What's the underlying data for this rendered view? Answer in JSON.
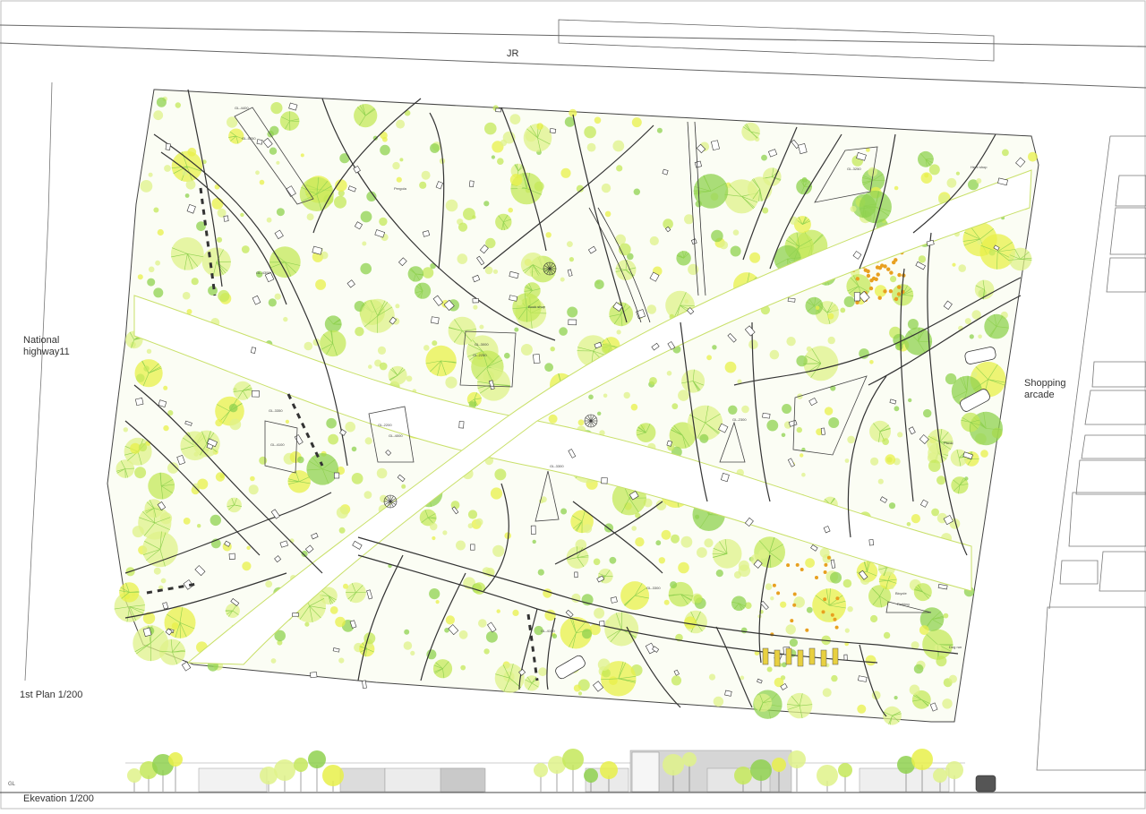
{
  "labels": {
    "rail": "JR",
    "highway": "National highway11",
    "arcade": "Shopping arcade",
    "plan_title": "1st Plan 1/200",
    "elevation_title": "Ekevation 1/200",
    "ground_line": "GL"
  },
  "site_annotations": [
    "GL-4400",
    "GL-5250",
    "GL-4300",
    "GL-3250",
    "GL-3000",
    "GL-2250",
    "GL-2200",
    "GL-4000",
    "GL-3350",
    "GL-4100",
    "GL-3300",
    "GL-2300",
    "GL-4100",
    "GL-3300",
    "Bicycle",
    "Parking",
    "Dog run",
    "Picnic",
    "Pergola",
    "Herb shop",
    "Book shop"
  ],
  "colors": {
    "tree_light": "#dff28a",
    "tree_mid": "#c4e85a",
    "tree_green": "#8fd14f",
    "tree_yellow": "#e8f04a",
    "flower": "#e8a020",
    "line": "#333333",
    "path_edge": "#c9e06a",
    "building": "#d8d8d8"
  },
  "icons": [
    "car-icon",
    "compass-icon",
    "bench-icon"
  ]
}
